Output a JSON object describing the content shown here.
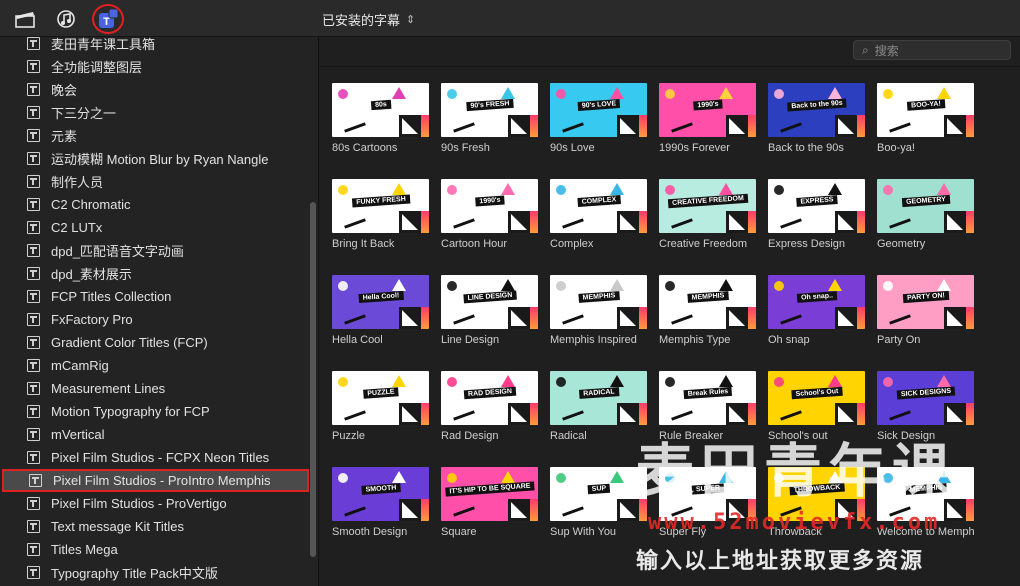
{
  "topbar": {
    "icons": [
      "clapper-icon",
      "music-icon",
      "titles-icon"
    ],
    "title": "已安装的字幕",
    "title_chevron": "⌃⌄"
  },
  "search": {
    "placeholder": "搜索",
    "icon": "search-icon"
  },
  "sidebar": {
    "items": [
      {
        "label": "麦田青年课工具箱"
      },
      {
        "label": "全功能调整图层"
      },
      {
        "label": "晚会"
      },
      {
        "label": "下三分之一"
      },
      {
        "label": "元素"
      },
      {
        "label": "运动模糊 Motion Blur by Ryan Nangle"
      },
      {
        "label": "制作人员"
      },
      {
        "label": "C2 Chromatic"
      },
      {
        "label": "C2 LUTx"
      },
      {
        "label": "dpd_匹配语音文字动画"
      },
      {
        "label": "dpd_素材展示"
      },
      {
        "label": "FCP Titles Collection"
      },
      {
        "label": "FxFactory Pro"
      },
      {
        "label": "Gradient Color Titles (FCP)"
      },
      {
        "label": "mCamRig"
      },
      {
        "label": "Measurement Lines"
      },
      {
        "label": "Motion Typography for FCP"
      },
      {
        "label": "mVertical"
      },
      {
        "label": "Pixel Film Studios - FCPX Neon Titles"
      },
      {
        "label": "Pixel Film Studios - ProIntro Memphis",
        "selected": true
      },
      {
        "label": "Pixel Film Studios - ProVertigo"
      },
      {
        "label": "Text message Kit Titles"
      },
      {
        "label": "Titles Mega"
      },
      {
        "label": "Typography Title Pack中文版"
      }
    ]
  },
  "tiles": [
    {
      "caption": "80s Cartoons",
      "thumb_text": "80s",
      "bg": "#ffffff",
      "accent": "#e23fb7"
    },
    {
      "caption": "90s Fresh",
      "thumb_text": "90's FRESH",
      "bg": "#ffffff",
      "accent": "#39c7e6"
    },
    {
      "caption": "90s Love",
      "thumb_text": "90's LOVE",
      "bg": "#38c9f0",
      "accent": "#ff4fa0"
    },
    {
      "caption": "1990s Forever",
      "thumb_text": "1990's",
      "bg": "#ff4fa8",
      "accent": "#ffd23a"
    },
    {
      "caption": "Back to the 90s",
      "thumb_text": "Back to the 90s",
      "bg": "#2b3fbf",
      "accent": "#ffb3d9"
    },
    {
      "caption": "Boo-ya!",
      "thumb_text": "BOO-YA!",
      "bg": "#ffffff",
      "accent": "#ffd400"
    },
    {
      "caption": "Bring It Back",
      "thumb_text": "FUNKY FRESH",
      "bg": "#ffffff",
      "accent": "#ffd400"
    },
    {
      "caption": "Cartoon Hour",
      "thumb_text": "1990's",
      "bg": "#ffffff",
      "accent": "#ff6ab0"
    },
    {
      "caption": "Complex",
      "thumb_text": "COMPLEX",
      "bg": "#ffffff",
      "accent": "#39b6e6"
    },
    {
      "caption": "Creative Freedom",
      "thumb_text": "CREATIVE FREEDOM",
      "bg": "#b9ece0",
      "accent": "#ff4fa0"
    },
    {
      "caption": "Express Design",
      "thumb_text": "EXPRESS",
      "bg": "#ffffff",
      "accent": "#111111"
    },
    {
      "caption": "Geometry",
      "thumb_text": "GEOMETRY",
      "bg": "#9fe0d0",
      "accent": "#ff6aa8"
    },
    {
      "caption": "Hella Cool",
      "thumb_text": "Hella Cool!",
      "bg": "#6c4ad8",
      "accent": "#ffffff"
    },
    {
      "caption": "Line Design",
      "thumb_text": "LINE DESIGN",
      "bg": "#ffffff",
      "accent": "#111111"
    },
    {
      "caption": "Memphis Inspired",
      "thumb_text": "MEMPHIS",
      "bg": "#ffffff",
      "accent": "#c9c9c9"
    },
    {
      "caption": "Memphis Type",
      "thumb_text": "MEMPHIS",
      "bg": "#ffffff",
      "accent": "#111111"
    },
    {
      "caption": "Oh snap",
      "thumb_text": "Oh snap..",
      "bg": "#7a3ed6",
      "accent": "#ffd400"
    },
    {
      "caption": "Party On",
      "thumb_text": "PARTY ON!",
      "bg": "#ff9ec4",
      "accent": "#ffffff"
    },
    {
      "caption": "Puzzle",
      "thumb_text": "PUZZLE",
      "bg": "#ffffff",
      "accent": "#ffd400"
    },
    {
      "caption": "Rad Design",
      "thumb_text": "RAD DESIGN",
      "bg": "#ffffff",
      "accent": "#ff3b8a"
    },
    {
      "caption": "Radical",
      "thumb_text": "RADICAL",
      "bg": "#a8e6d8",
      "accent": "#111111"
    },
    {
      "caption": "Rule Breaker",
      "thumb_text": "Break Rules",
      "bg": "#ffffff",
      "accent": "#111111"
    },
    {
      "caption": "School's out",
      "thumb_text": "School's Out",
      "bg": "#ffd400",
      "accent": "#ff3b8a"
    },
    {
      "caption": "Sick Design",
      "thumb_text": "SICK DESIGNS",
      "bg": "#5a3ed6",
      "accent": "#ff6aa8"
    },
    {
      "caption": "Smooth Design",
      "thumb_text": "SMOOTH",
      "bg": "#6a3ed6",
      "accent": "#ffffff"
    },
    {
      "caption": "Square",
      "thumb_text": "IT'S HIP TO BE SQUARE",
      "bg": "#ff4fa8",
      "accent": "#ffd400"
    },
    {
      "caption": "Sup With You",
      "thumb_text": "SUP",
      "bg": "#ffffff",
      "accent": "#3cc87a"
    },
    {
      "caption": "Super Fly",
      "thumb_text": "SUPER",
      "bg": "#ffffff",
      "accent": "#39b6e6"
    },
    {
      "caption": "Throwback",
      "thumb_text": "THROWBACK",
      "bg": "#ffd400",
      "accent": "#ffffff"
    },
    {
      "caption": "Welcome to Memphis",
      "thumb_text": "MEMPHIS",
      "bg": "#ffffff",
      "accent": "#39b6e6"
    }
  ],
  "watermark": {
    "big": "麦田青年课",
    "url": "www.52movievfx.com",
    "sub": "输入以上地址获取更多资源"
  }
}
